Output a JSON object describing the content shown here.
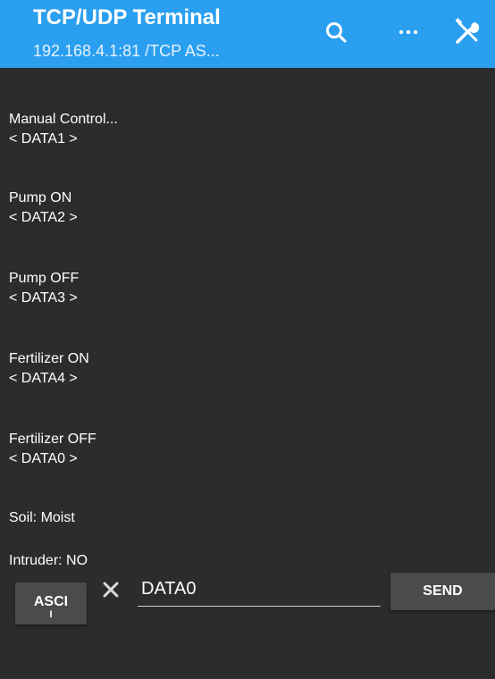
{
  "appbar": {
    "title": "TCP/UDP Terminal",
    "subtitle": "192.168.4.1:81 /TCP  AS...",
    "bg_color": "#2a9ff0",
    "icons": [
      "search-icon",
      "more-icon",
      "tools-icon"
    ]
  },
  "terminal": {
    "lines": [
      "Manual Control...",
      "< DATA1 >",
      "Pump ON",
      "< DATA2 >",
      "Pump OFF",
      "< DATA3 >",
      "Fertilizer ON",
      "< DATA4 >",
      "Fertilizer OFF",
      "< DATA0 >",
      "Soil: Moist",
      "Intruder: NO"
    ]
  },
  "input_bar": {
    "mode_label_top": "ASCI",
    "mode_label_bottom": "I",
    "input_value": "DATA0",
    "send_label": "SEND",
    "clear_icon": "close-icon"
  }
}
